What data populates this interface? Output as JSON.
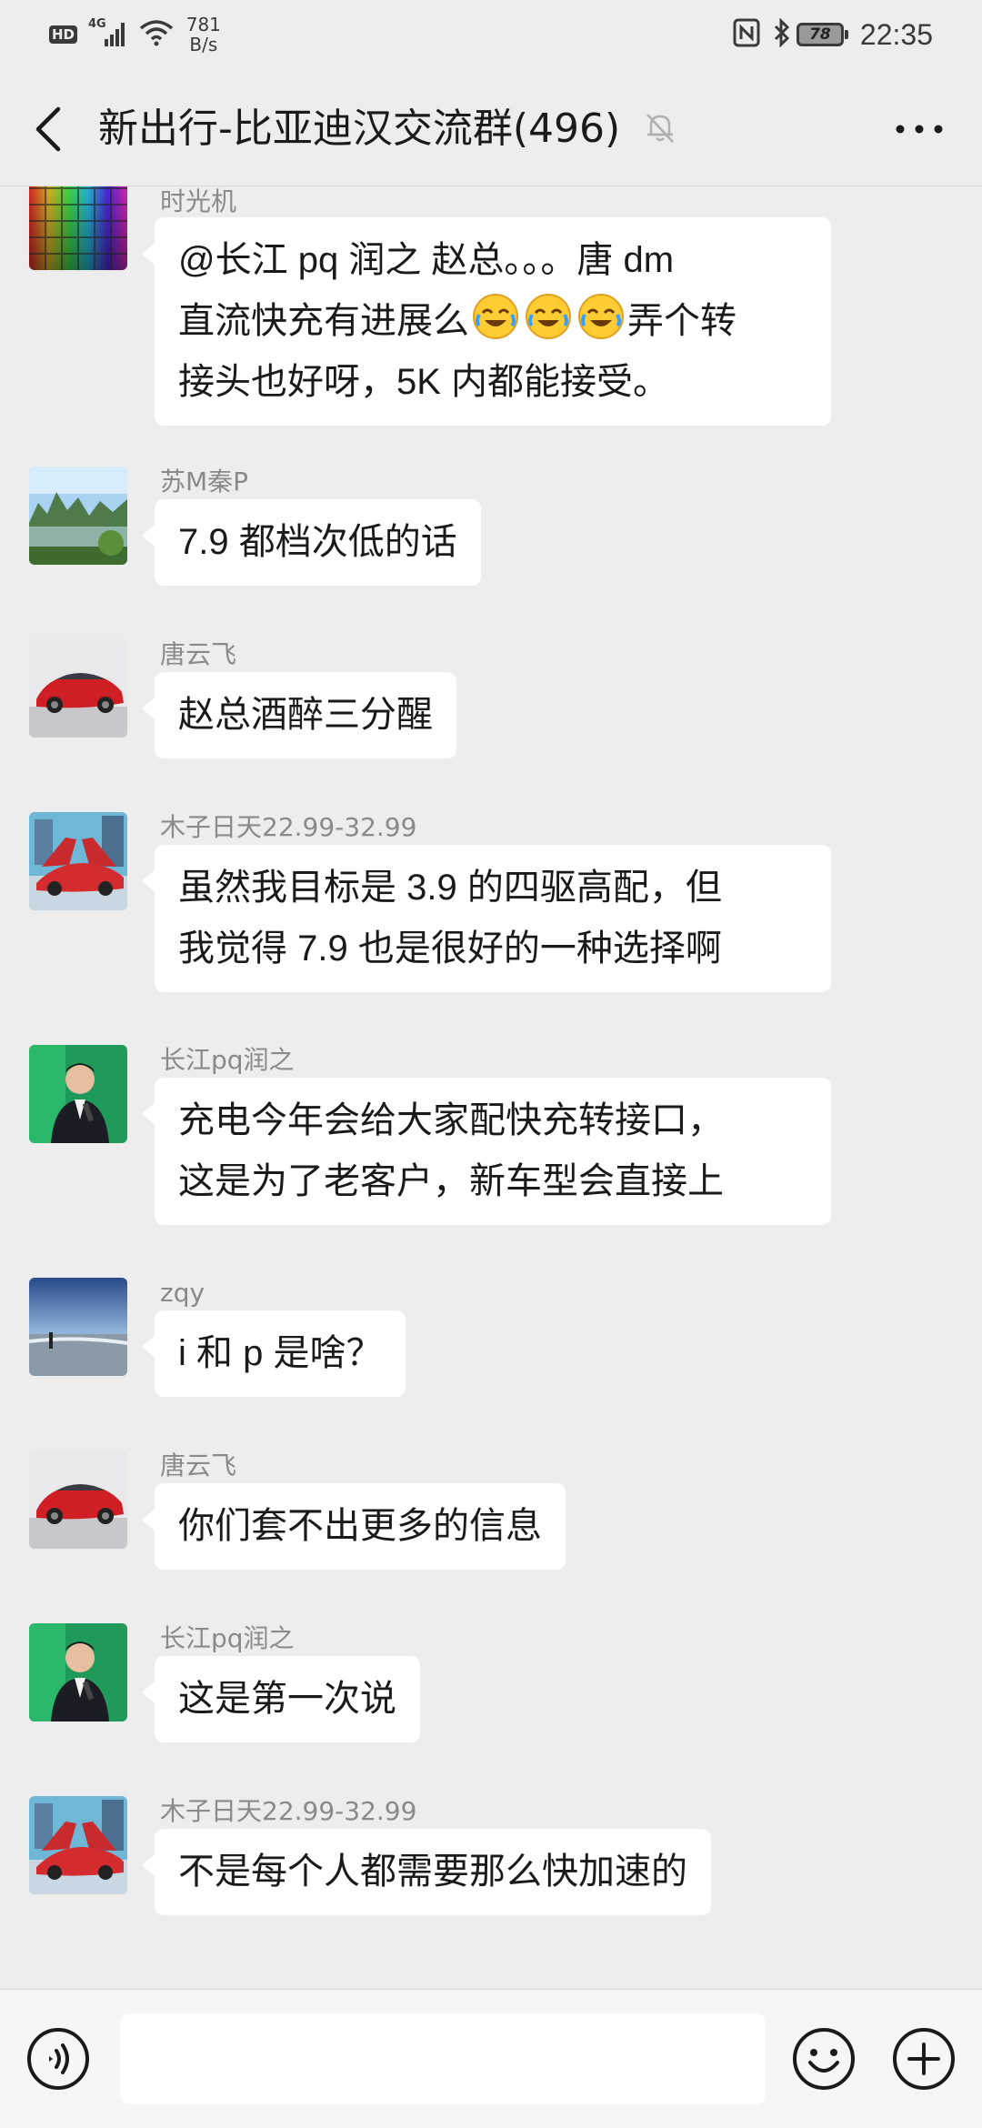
{
  "status_bar": {
    "hd": "HD",
    "network": "4G",
    "speed_value": "781",
    "speed_unit": "B/s",
    "battery": "78",
    "time": "22:35"
  },
  "header": {
    "title": "新出行-比亚迪汉交流群(496)"
  },
  "messages": [
    {
      "sender": "时光机",
      "lines": [
        "@长江 pq 润之  赵总。。。唐 dm",
        "直流快充有进展么",
        "接头也好呀，5K 内都能接受。"
      ],
      "line2_tail": "弄个转"
    },
    {
      "sender": "苏M秦P",
      "text": "7.9 都档次低的话"
    },
    {
      "sender": "唐云飞",
      "text": "赵总酒醉三分醒"
    },
    {
      "sender": "木子日天22.99-32.99",
      "lines": [
        "虽然我目标是 3.9 的四驱高配，但",
        "我觉得 7.9 也是很好的一种选择啊"
      ]
    },
    {
      "sender": "长江pq润之",
      "lines": [
        "充电今年会给大家配快充转接口，",
        "这是为了老客户，新车型会直接上"
      ]
    },
    {
      "sender": "zqy",
      "text": "i 和 p 是啥？"
    },
    {
      "sender": "唐云飞",
      "text": "你们套不出更多的信息"
    },
    {
      "sender": "长江pq润之",
      "text": "这是第一次说"
    },
    {
      "sender": "木子日天22.99-32.99",
      "text": "不是每个人都需要那么快加速的"
    }
  ],
  "colors": {
    "background": "#ededed",
    "bubble": "#ffffff",
    "sender_text": "#8a8a8a",
    "input_bar": "#f6f6f6"
  }
}
